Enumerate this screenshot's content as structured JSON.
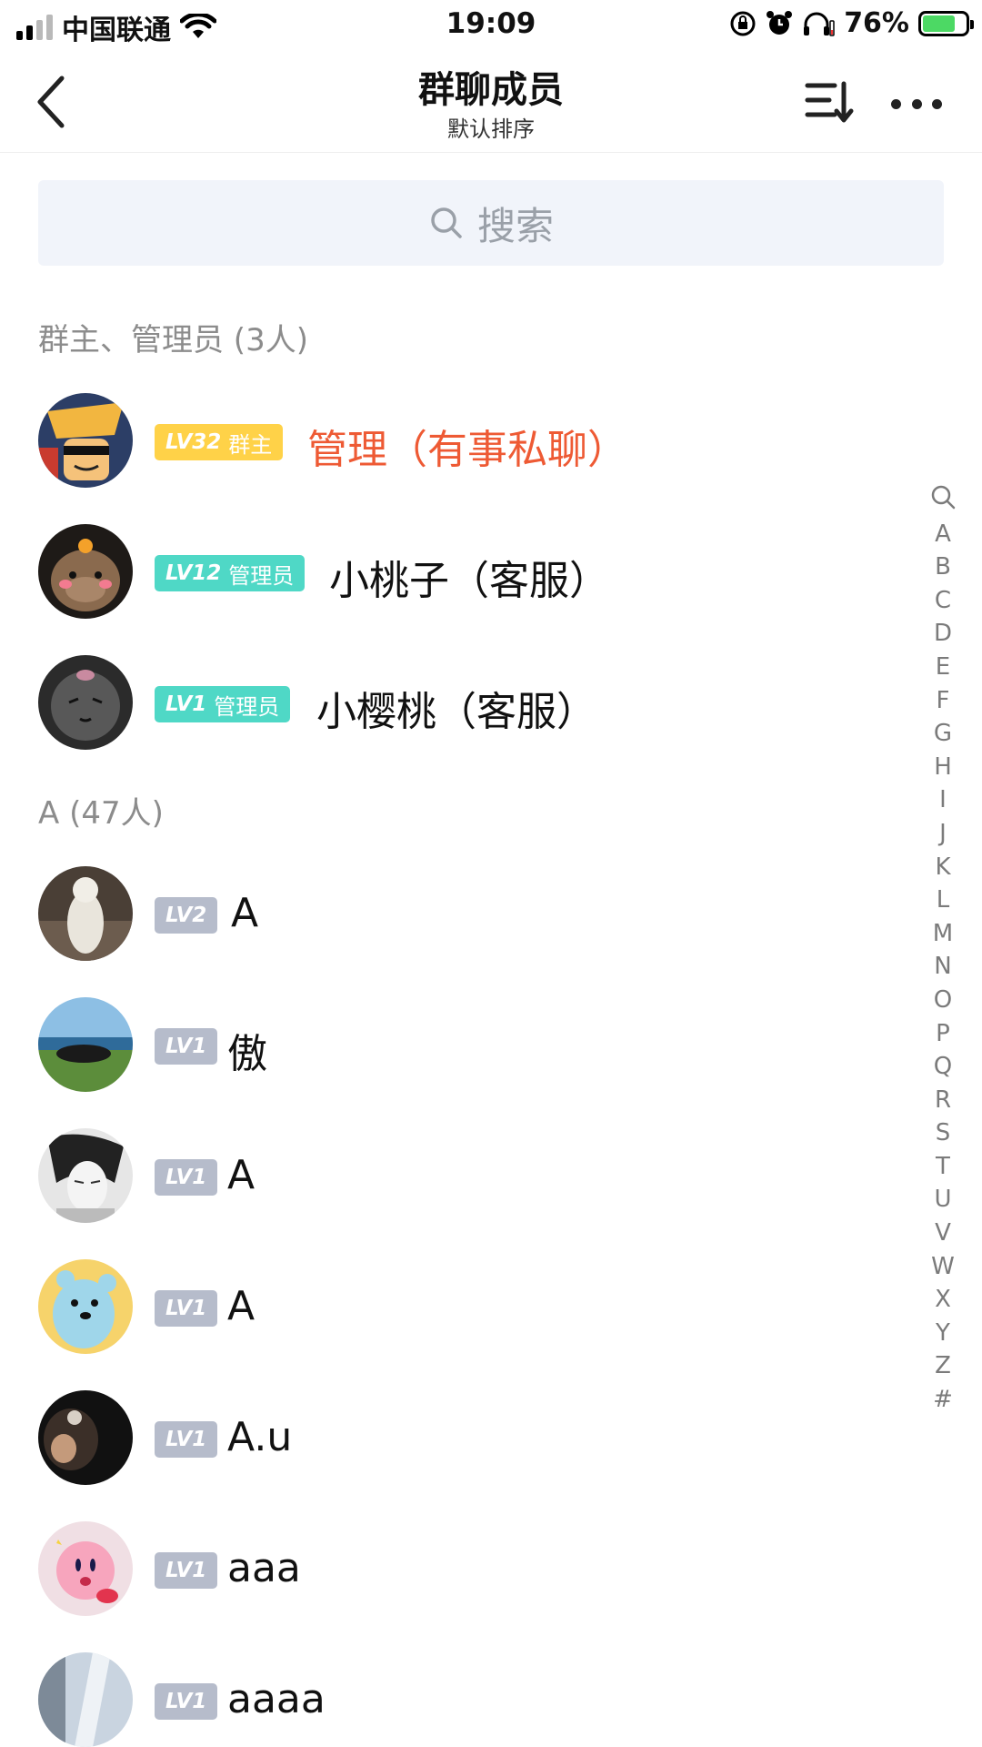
{
  "status_bar": {
    "carrier": "中国联通",
    "time": "19:09",
    "battery": "76%",
    "battery_level": 0.76
  },
  "nav": {
    "title": "群聊成员",
    "subtitle": "默认排序",
    "icons": [
      "chevron-left-icon",
      "sort-icon",
      "more-icon"
    ]
  },
  "search": {
    "placeholder": "搜索"
  },
  "sections": [
    {
      "header": "群主、管理员 (3人)"
    },
    {
      "header": "A (47人)"
    }
  ],
  "admins": [
    {
      "lv": "LV32",
      "role": "群主",
      "name": "管理（有事私聊）",
      "badge_color": "#ffd248",
      "name_color": "#ee5a34"
    },
    {
      "lv": "LV12",
      "role": "管理员",
      "name": "小桃子（客服）",
      "badge_color": "#4fd8c6"
    },
    {
      "lv": "LV1",
      "role": "管理员",
      "name": "小樱桃（客服）",
      "badge_color": "#4fd8c6"
    }
  ],
  "members_a": [
    {
      "lv": "LV2",
      "name": "A"
    },
    {
      "lv": "LV1",
      "name": "傲"
    },
    {
      "lv": "LV1",
      "name": "A"
    },
    {
      "lv": "LV1",
      "name": "A"
    },
    {
      "lv": "LV1",
      "name": "A.u"
    },
    {
      "lv": "LV1",
      "name": "aaa"
    },
    {
      "lv": "LV1",
      "name": "aaaa"
    }
  ],
  "index_bar": [
    "A",
    "B",
    "C",
    "D",
    "E",
    "F",
    "G",
    "H",
    "I",
    "J",
    "K",
    "L",
    "M",
    "N",
    "O",
    "P",
    "Q",
    "R",
    "S",
    "T",
    "U",
    "V",
    "W",
    "X",
    "Y",
    "Z",
    "#"
  ]
}
